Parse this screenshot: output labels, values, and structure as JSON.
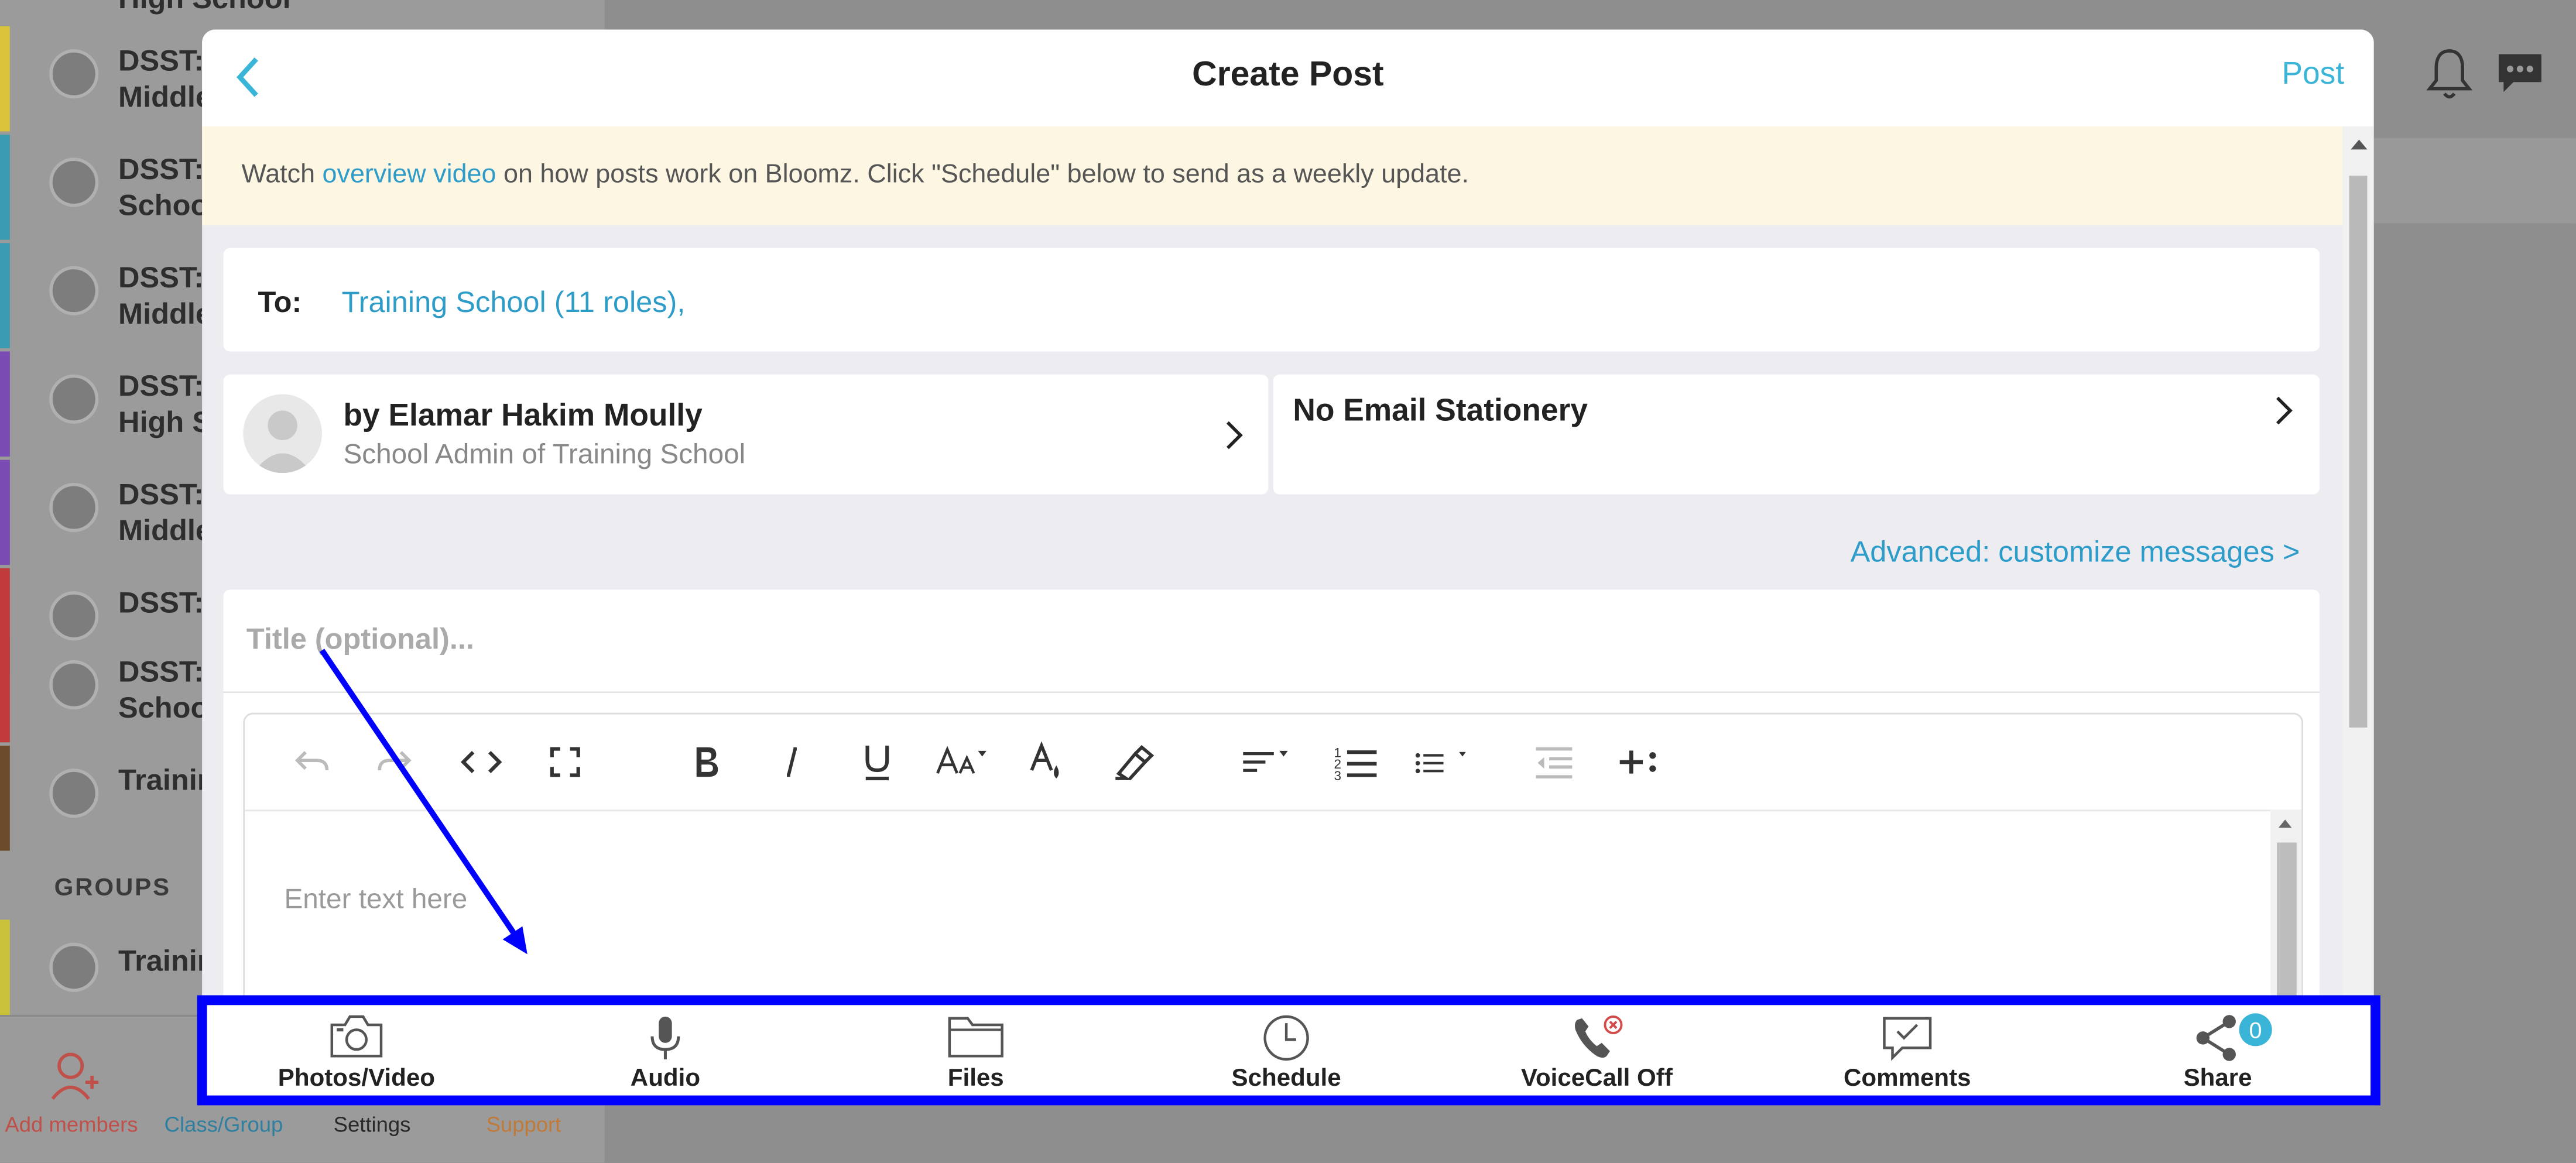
{
  "sidebar": {
    "items": [
      {
        "label": "DSST:\nMiddle",
        "bar": "#d9c33a"
      },
      {
        "label": "DSST:\nSchoo",
        "bar": "#3a9bb3"
      },
      {
        "label": "DSST:\nMiddle",
        "bar": "#3a9bb3"
      },
      {
        "label": "DSST:\nHigh S",
        "bar": "#7a4bb3"
      },
      {
        "label": "DSST:\nMiddle",
        "bar": "#7a4bb3"
      },
      {
        "label": "DSST:",
        "bar": "#c23b3b"
      },
      {
        "label": "DSST:\nSchoo",
        "bar": "#c23b3b"
      },
      {
        "label": "Trainin",
        "bar": "#6b4b2b"
      }
    ],
    "top_partial": "High School",
    "groups_heading": "GROUPS",
    "group_item": "Trainin",
    "footer": {
      "add_members": "Add members",
      "class_group": "Class/Group",
      "settings": "Settings",
      "support": "Support"
    }
  },
  "modal": {
    "title": "Create Post",
    "post_label": "Post",
    "notice": {
      "prefix": "Watch ",
      "link": "overview video",
      "suffix": " on how posts work on Bloomz. Click \"Schedule\" below to send as a weekly update."
    },
    "to_label": "To:",
    "to_value": "Training School (11 roles),",
    "author_name": "by Elamar Hakim Moully",
    "author_role": "School Admin of Training School",
    "stationery": "No Email Stationery",
    "advanced": "Advanced: customize messages >",
    "title_placeholder": "Title (optional)...",
    "body_placeholder": "Enter text here"
  },
  "attachments": [
    {
      "label": "Photos/Video",
      "icon": "camera-icon"
    },
    {
      "label": "Audio",
      "icon": "microphone-icon"
    },
    {
      "label": "Files",
      "icon": "folder-icon"
    },
    {
      "label": "Schedule",
      "icon": "clock-icon"
    },
    {
      "label": "VoiceCall Off",
      "icon": "phone-off-icon"
    },
    {
      "label": "Comments",
      "icon": "comment-icon"
    },
    {
      "label": "Share",
      "icon": "share-icon",
      "badge": "0"
    }
  ],
  "colors": {
    "accent": "#3ab5d7",
    "link": "#2e9cc9",
    "highlight": "#0000ff",
    "notice_bg": "#fcf6e3"
  }
}
